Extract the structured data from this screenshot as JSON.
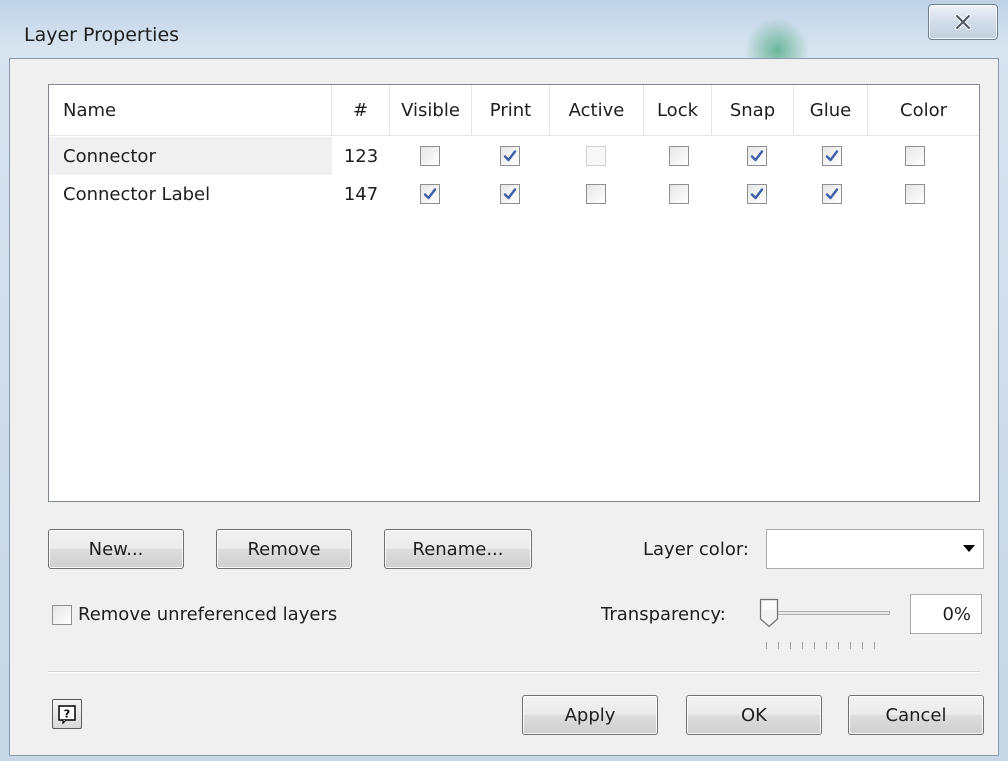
{
  "window": {
    "title": "Layer Properties"
  },
  "columns": [
    "Name",
    "#",
    "Visible",
    "Print",
    "Active",
    "Lock",
    "Snap",
    "Glue",
    "Color"
  ],
  "layers": [
    {
      "name": "Connector",
      "count": "123",
      "visible": false,
      "print": true,
      "active": false,
      "active_disabled": true,
      "lock": false,
      "snap": true,
      "glue": true,
      "color": false
    },
    {
      "name": "Connector Label",
      "count": "147",
      "visible": true,
      "print": true,
      "active": false,
      "active_disabled": false,
      "lock": false,
      "snap": true,
      "glue": true,
      "color": false
    }
  ],
  "buttons": {
    "new": "New...",
    "remove": "Remove",
    "rename": "Rename...",
    "apply": "Apply",
    "ok": "OK",
    "cancel": "Cancel"
  },
  "layer_color": {
    "label": "Layer color:",
    "value": ""
  },
  "remove_unreferenced": {
    "label": "Remove unreferenced layers",
    "checked": false
  },
  "transparency": {
    "label": "Transparency:",
    "value": "0%",
    "level": 0
  },
  "icons": {
    "close": "close-icon",
    "help": "help-icon",
    "check": "checkmark-icon",
    "dropdown": "chevron-down-icon"
  },
  "colors": {
    "check": "#3c5fa8",
    "title_bg": "#c7d7e6",
    "dialog_bg": "#f0f0f0"
  }
}
